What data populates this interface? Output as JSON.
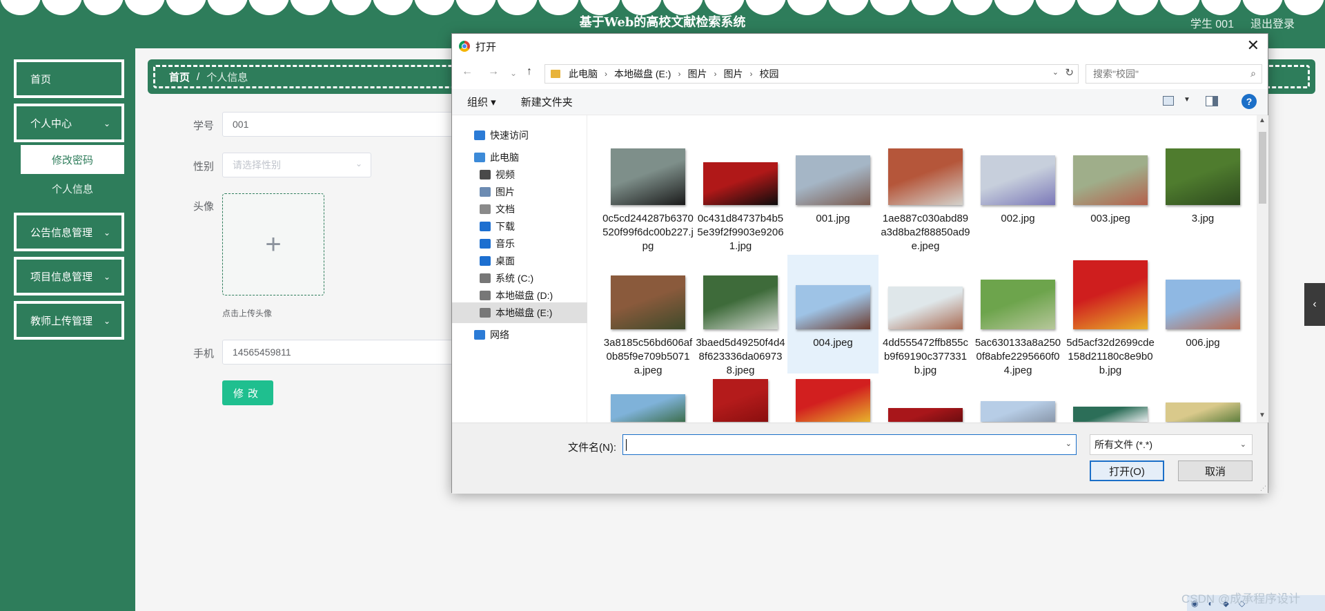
{
  "app": {
    "site_title": "基于Web的高校文献检索系统",
    "user_label": "学生 001",
    "logout": "退出登录"
  },
  "sidebar": {
    "items": [
      {
        "label": "首页",
        "has_children": false
      },
      {
        "label": "个人中心",
        "has_children": true
      },
      {
        "label": "公告信息管理",
        "has_children": true
      },
      {
        "label": "项目信息管理",
        "has_children": true
      },
      {
        "label": "教师上传管理",
        "has_children": true
      }
    ],
    "submenu": [
      {
        "label": "修改密码",
        "active": true
      },
      {
        "label": "个人信息",
        "active": false
      }
    ]
  },
  "breadcrumb": {
    "home": "首页",
    "separator": "/",
    "current": "个人信息"
  },
  "form": {
    "student_id_label": "学号",
    "student_id_value": "001",
    "gender_label": "性别",
    "gender_placeholder": "请选择性别",
    "avatar_label": "头像",
    "upload_plus": "+",
    "upload_tip": "点击上传头像",
    "phone_label": "手机",
    "phone_value": "14565459811",
    "submit_label": "修改"
  },
  "dialog": {
    "title": "打开",
    "close_glyph": "✕",
    "nav": {
      "back": "←",
      "forward": "→",
      "recent": "⌄",
      "up": "↑"
    },
    "path": [
      "此电脑",
      "本地磁盘 (E:)",
      "图片",
      "图片",
      "校园"
    ],
    "search_placeholder": "搜索\"校园\"",
    "toolbar": {
      "organize": "组织 ▾",
      "new_folder": "新建文件夹",
      "help": "?"
    },
    "nav_pane": [
      {
        "label": "快速访问",
        "icon": "star-icon",
        "color": "#2b7bd6"
      },
      {
        "label": "此电脑",
        "icon": "computer-icon",
        "color": "#3c8ad8"
      },
      {
        "label": "视频",
        "icon": "video-icon",
        "color": "#4a4a4a"
      },
      {
        "label": "图片",
        "icon": "pictures-icon",
        "color": "#6c8bb2"
      },
      {
        "label": "文档",
        "icon": "documents-icon",
        "color": "#8a8a8a"
      },
      {
        "label": "下载",
        "icon": "download-icon",
        "color": "#1d6fd0"
      },
      {
        "label": "音乐",
        "icon": "music-icon",
        "color": "#1d6fd0"
      },
      {
        "label": "桌面",
        "icon": "desktop-icon",
        "color": "#1d6fd0"
      },
      {
        "label": "系统 (C:)",
        "icon": "drive-icon",
        "color": "#777777"
      },
      {
        "label": "本地磁盘 (D:)",
        "icon": "drive-icon",
        "color": "#777777"
      },
      {
        "label": "本地磁盘 (E:)",
        "icon": "drive-icon",
        "color": "#777777",
        "selected": true
      },
      {
        "label": "网络",
        "icon": "network-icon",
        "color": "#2b7bd6"
      }
    ],
    "files": [
      {
        "name": "0c5cd244287b6370520f99f6dc00b227.jpg",
        "colors": [
          "#7e8f8a",
          "#1a1a1a"
        ]
      },
      {
        "name": "0c431d84737b4b55e39f2f9903e92061.jpg",
        "colors": [
          "#b01818",
          "#0c0c0c"
        ]
      },
      {
        "name": "001.jpg",
        "colors": [
          "#a5b6c6",
          "#7a5a4e"
        ]
      },
      {
        "name": "1ae887c030abd89a3d8ba2f88850ad9e.jpeg",
        "colors": [
          "#b5563a",
          "#d4d2cc"
        ]
      },
      {
        "name": "002.jpg",
        "colors": [
          "#c7cfdc",
          "#7b78b8"
        ]
      },
      {
        "name": "003.jpeg",
        "colors": [
          "#9fae8a",
          "#b4604c"
        ]
      },
      {
        "name": "3.jpg",
        "colors": [
          "#4f7c2e",
          "#2d4a1e"
        ]
      },
      {
        "name": "3a8185c56bd606af0b85f9e709b5071a.jpeg",
        "colors": [
          "#8a5a3c",
          "#3e4a2a"
        ]
      },
      {
        "name": "3baed5d49250f4d48f623336da069738.jpeg",
        "colors": [
          "#3e6b3a",
          "#d3d8d1"
        ]
      },
      {
        "name": "004.jpeg",
        "colors": [
          "#9ec3e6",
          "#6b3a2c"
        ]
      },
      {
        "name": "4dd555472ffb855cb9f69190c377331b.jpg",
        "colors": [
          "#dfe7ea",
          "#a86a52"
        ]
      },
      {
        "name": "5ac630133a8a2500f8abfe2295660f04.jpeg",
        "colors": [
          "#6da44c",
          "#b7c79b"
        ]
      },
      {
        "name": "5d5acf32d2699cde158d21180c8e9b0b.jpg",
        "colors": [
          "#cf1e1e",
          "#e9b32b"
        ]
      },
      {
        "name": "006.jpg",
        "colors": [
          "#8fb8e3",
          "#b66b52"
        ]
      },
      {
        "name": "",
        "colors": [
          "#7fb2d9",
          "#3d6e4d"
        ]
      },
      {
        "name": "",
        "colors": [
          "#b41b1b",
          "#8a0f0f"
        ]
      },
      {
        "name": "",
        "colors": [
          "#d21f1f",
          "#e7b32c"
        ]
      },
      {
        "name": "",
        "colors": [
          "#a8161a",
          "#6c0d10"
        ]
      },
      {
        "name": "",
        "colors": [
          "#b7cde6",
          "#8a98ab"
        ]
      },
      {
        "name": "",
        "colors": [
          "#2c6e58",
          "#e9ecee"
        ]
      },
      {
        "name": "",
        "colors": [
          "#d9c98b",
          "#5f7f3e"
        ]
      }
    ],
    "filename_label": "文件名(N):",
    "filename_value": "",
    "file_type": "所有文件 (*.*)",
    "open_button": "打开(O)",
    "cancel_button": "取消"
  },
  "overlay": {
    "side_handle": "‹",
    "watermark": "CSDN @成承程序设计"
  },
  "colors": {
    "brand": "#2e7d5b",
    "submit": "#1fbf8f",
    "win_accent": "#1b6fc8"
  }
}
